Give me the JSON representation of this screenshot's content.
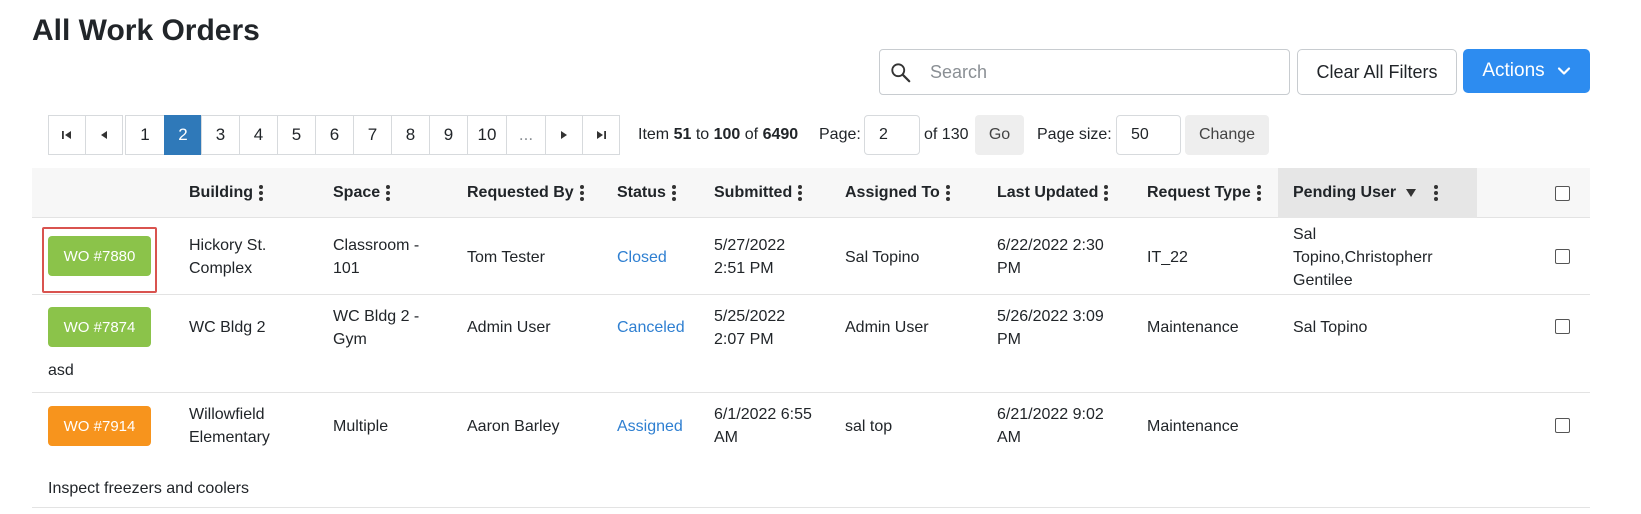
{
  "page": {
    "title": "All Work Orders"
  },
  "toolbar": {
    "search_placeholder": "Search",
    "search_value": "",
    "clear_filters_label": "Clear All Filters",
    "actions_label": "Actions"
  },
  "pagination": {
    "pages": [
      "1",
      "2",
      "3",
      "4",
      "5",
      "6",
      "7",
      "8",
      "9",
      "10",
      "..."
    ],
    "current_page": "2",
    "info_prefix": "Item",
    "range_start": "51",
    "range_to": "to",
    "range_end": "100",
    "range_of": "of",
    "total_items": "6490",
    "page_label": "Page:",
    "page_value": "2",
    "of_pages": "of 130",
    "go_label": "Go",
    "page_size_label": "Page size:",
    "page_size_value": "50",
    "change_label": "Change"
  },
  "table": {
    "columns": {
      "building": "Building",
      "space": "Space",
      "requested_by": "Requested By",
      "status": "Status",
      "submitted": "Submitted",
      "assigned_to": "Assigned To",
      "last_updated": "Last Updated",
      "request_type": "Request Type",
      "pending_user": "Pending User"
    },
    "rows": [
      {
        "wo": "WO #7880",
        "wo_color": "#8bc34a",
        "building": "Hickory St. Complex",
        "space": "Classroom - 101",
        "requested_by": "Tom Tester",
        "status": "Closed",
        "submitted": "5/27/2022 2:51 PM",
        "assigned_to": "Sal Topino",
        "last_updated": "6/22/2022 2:30 PM",
        "request_type": "IT_22",
        "pending_user": "Sal Topino,Christopherr Gentilee",
        "description": ""
      },
      {
        "wo": "WO #7874",
        "wo_color": "#8bc34a",
        "building": "WC Bldg 2",
        "space": "WC Bldg 2 - Gym",
        "requested_by": "Admin User",
        "status": "Canceled",
        "submitted": "5/25/2022 2:07 PM",
        "assigned_to": "Admin User",
        "last_updated": "5/26/2022 3:09 PM",
        "request_type": "Maintenance",
        "pending_user": "Sal Topino",
        "description": "asd"
      },
      {
        "wo": "WO #7914",
        "wo_color": "#f7941d",
        "building": "Willowfield Elementary",
        "space": "Multiple",
        "requested_by": "Aaron Barley",
        "status": "Assigned",
        "submitted": "6/1/2022 6:55 AM",
        "assigned_to": "sal top",
        "last_updated": "6/21/2022 9:02 AM",
        "request_type": "Maintenance",
        "pending_user": "",
        "description": "Inspect freezers and coolers"
      }
    ]
  }
}
